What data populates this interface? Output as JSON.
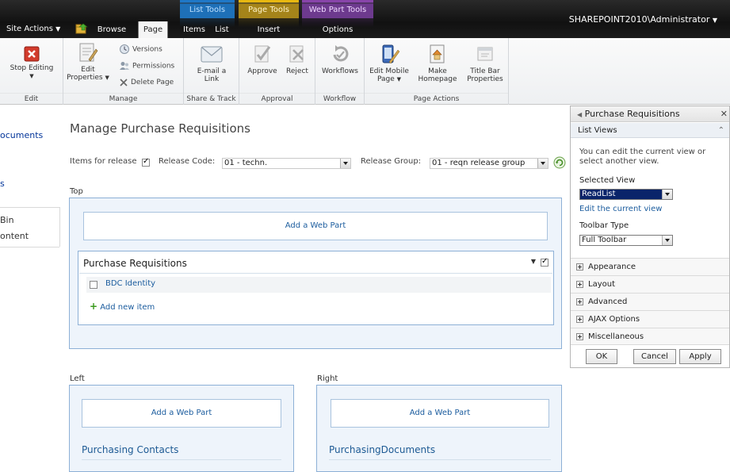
{
  "top_bar": {
    "site_actions": "Site Actions",
    "tabs": {
      "browse": "Browse",
      "page": "Page",
      "items": "Items",
      "list": "List",
      "insert": "Insert",
      "options": "Options"
    },
    "context_groups": {
      "list_tools": "List Tools",
      "page_tools": "Page Tools",
      "web_part_tools": "Web Part Tools"
    },
    "user": "SHAREPOINT2010\\Administrator"
  },
  "ribbon": {
    "edit": {
      "label": "Edit",
      "stop_editing": "Stop Editing"
    },
    "manage": {
      "label": "Manage",
      "edit_properties_1": "Edit",
      "edit_properties_2": "Properties",
      "versions": "Versions",
      "permissions": "Permissions",
      "delete_page": "Delete Page"
    },
    "share_track": {
      "label": "Share & Track",
      "email_1": "E-mail a",
      "email_2": "Link"
    },
    "approval": {
      "label": "Approval",
      "approve": "Approve",
      "reject": "Reject"
    },
    "workflow": {
      "label": "Workflow",
      "workflows": "Workflows"
    },
    "page_actions": {
      "label": "Page Actions",
      "edit_mobile_1": "Edit Mobile",
      "edit_mobile_2": "Page",
      "make_homepage_1": "Make",
      "make_homepage_2": "Homepage",
      "title_bar_1": "Title Bar",
      "title_bar_2": "Properties"
    }
  },
  "left_nav": {
    "documents": "ocuments",
    "s": "s",
    "bin": "Bin",
    "content": "ontent"
  },
  "main": {
    "title": "Manage Purchase Requisitions",
    "filter": {
      "items_for_release": "Items for release",
      "release_code_label": "Release Code:",
      "release_code_value": "01 - techn.",
      "release_group_label": "Release Group:",
      "release_group_value": "01 - reqn release group"
    },
    "zones": {
      "top": "Top",
      "left": "Left",
      "right": "Right",
      "add_web_part": "Add a Web Part"
    },
    "purchase_requisitions": {
      "title": "Purchase Requisitions",
      "row": "BDC Identity",
      "add_new_item": "Add new item"
    },
    "purchasing_contacts": "Purchasing Contacts",
    "purchasing_documents": "PurchasingDocuments"
  },
  "tool_pane": {
    "title": "Purchase Requisitions",
    "list_views": "List Views",
    "help_1": "You can edit the current view or",
    "help_2": "select another view.",
    "selected_view_label": "Selected View",
    "selected_view_value": "ReadList",
    "edit_current_view": "Edit the current view",
    "toolbar_type_label": "Toolbar Type",
    "toolbar_type_value": "Full Toolbar",
    "sections": [
      "Appearance",
      "Layout",
      "Advanced",
      "AJAX Options",
      "Miscellaneous"
    ],
    "buttons": {
      "ok": "OK",
      "cancel": "Cancel",
      "apply": "Apply"
    }
  },
  "colors": {
    "top_bar": "#1a1a1a",
    "list_tools": "#1f78c8",
    "page_tools": "#e8b810",
    "web_part_tools": "#8844aa",
    "link": "#1b5c9e",
    "selected_view": "#0a246a"
  }
}
